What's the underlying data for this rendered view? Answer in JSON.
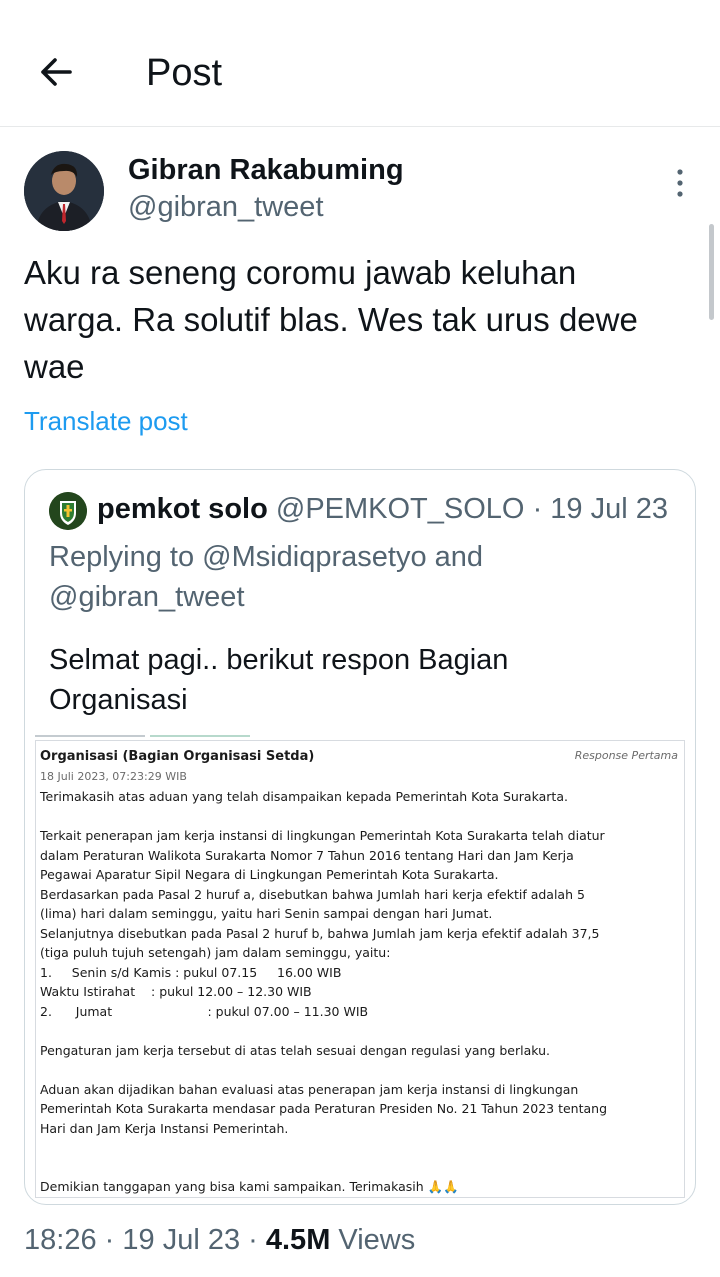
{
  "header": {
    "title": "Post",
    "back_icon": "arrow-left-icon"
  },
  "author": {
    "name": "Gibran Rakabuming",
    "handle": "@gibran_tweet"
  },
  "post": {
    "text": "Aku ra seneng coromu jawab keluhan warga. Ra solutif blas. Wes tak urus dewe wae",
    "translate_label": "Translate post"
  },
  "quoted": {
    "name": "pemkot solo",
    "handle": "@PEMKOT_SOLO",
    "separator": "·",
    "date": "19 Jul 23",
    "replying": "Replying to @Msidiqprasetyo and @gibran_tweet",
    "text": "Selmat pagi.. berikut respon Bagian Organisasi",
    "document": {
      "title": "Organisasi (Bagian Organisasi Setda)",
      "tag": "Response Pertama",
      "date": "18 Juli 2023, 07:23:29 WIB",
      "lines": {
        "l1": "Terimakasih atas aduan yang telah disampaikan kepada Pemerintah Kota Surakarta.",
        "l2": "Terkait penerapan jam kerja instansi di lingkungan Pemerintah Kota Surakarta telah diatur",
        "l3": "dalam Peraturan Walikota Surakarta Nomor 7 Tahun 2016 tentang Hari dan Jam Kerja",
        "l4": "Pegawai Aparatur Sipil Negara di Lingkungan Pemerintah Kota Surakarta.",
        "l5": "Berdasarkan pada Pasal 2 huruf a, disebutkan bahwa Jumlah hari kerja efektif adalah 5",
        "l6": "(lima) hari dalam seminggu, yaitu hari Senin sampai dengan hari Jumat.",
        "l7": "Selanjutnya disebutkan pada Pasal 2 huruf b, bahwa Jumlah jam kerja efektif adalah 37,5",
        "l8": "(tiga puluh tujuh setengah) jam dalam seminggu, yaitu:",
        "l9": "1.     Senin s/d Kamis : pukul 07.15     16.00 WIB",
        "l10": "Waktu Istirahat    : pukul 12.00 – 12.30 WIB",
        "l11": "2.      Jumat                        : pukul 07.00 – 11.30 WIB",
        "l12": "Pengaturan jam kerja tersebut di atas telah sesuai dengan regulasi yang berlaku.",
        "l13": "Aduan akan dijadikan bahan evaluasi atas penerapan jam kerja instansi di lingkungan",
        "l14": "Pemerintah Kota Surakarta mendasar pada Peraturan Presiden No. 21 Tahun 2023 tentang",
        "l15": "Hari dan Jam Kerja Instansi Pemerintah.",
        "l16": "Demikian tanggapan yang bisa kami sampaikan. Terimakasih 🙏🙏"
      }
    }
  },
  "meta": {
    "time": "18:26",
    "separator": "·",
    "date": "19 Jul 23",
    "views_count": "4.5M",
    "views_label": "Views"
  },
  "colors": {
    "accent": "#1d9bf0",
    "muted": "#536471",
    "text": "#0f1419"
  }
}
